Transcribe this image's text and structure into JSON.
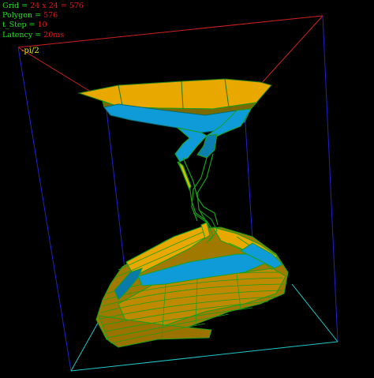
{
  "hud": {
    "grid_label": "Grid",
    "grid_value": "24 x 24 = 576",
    "polygon_label": "Polygon",
    "polygon_value": "576",
    "tstep_label": "t_Step",
    "tstep_value": "10",
    "latency_label": "Latency",
    "latency_value": "20ms"
  },
  "axis_label": "-pi/2",
  "colors": {
    "background": "#000000",
    "label_green": "#22e022",
    "value_red": "#e01b1b",
    "axis_yellow": "#e6e600",
    "box_top": "#d02020",
    "box_side": "#2020d0",
    "box_bottom": "#20c8c8",
    "surface_orange": "#e0a000",
    "surface_blue": "#0f9bd7",
    "mesh_green": "#1aa01a"
  }
}
